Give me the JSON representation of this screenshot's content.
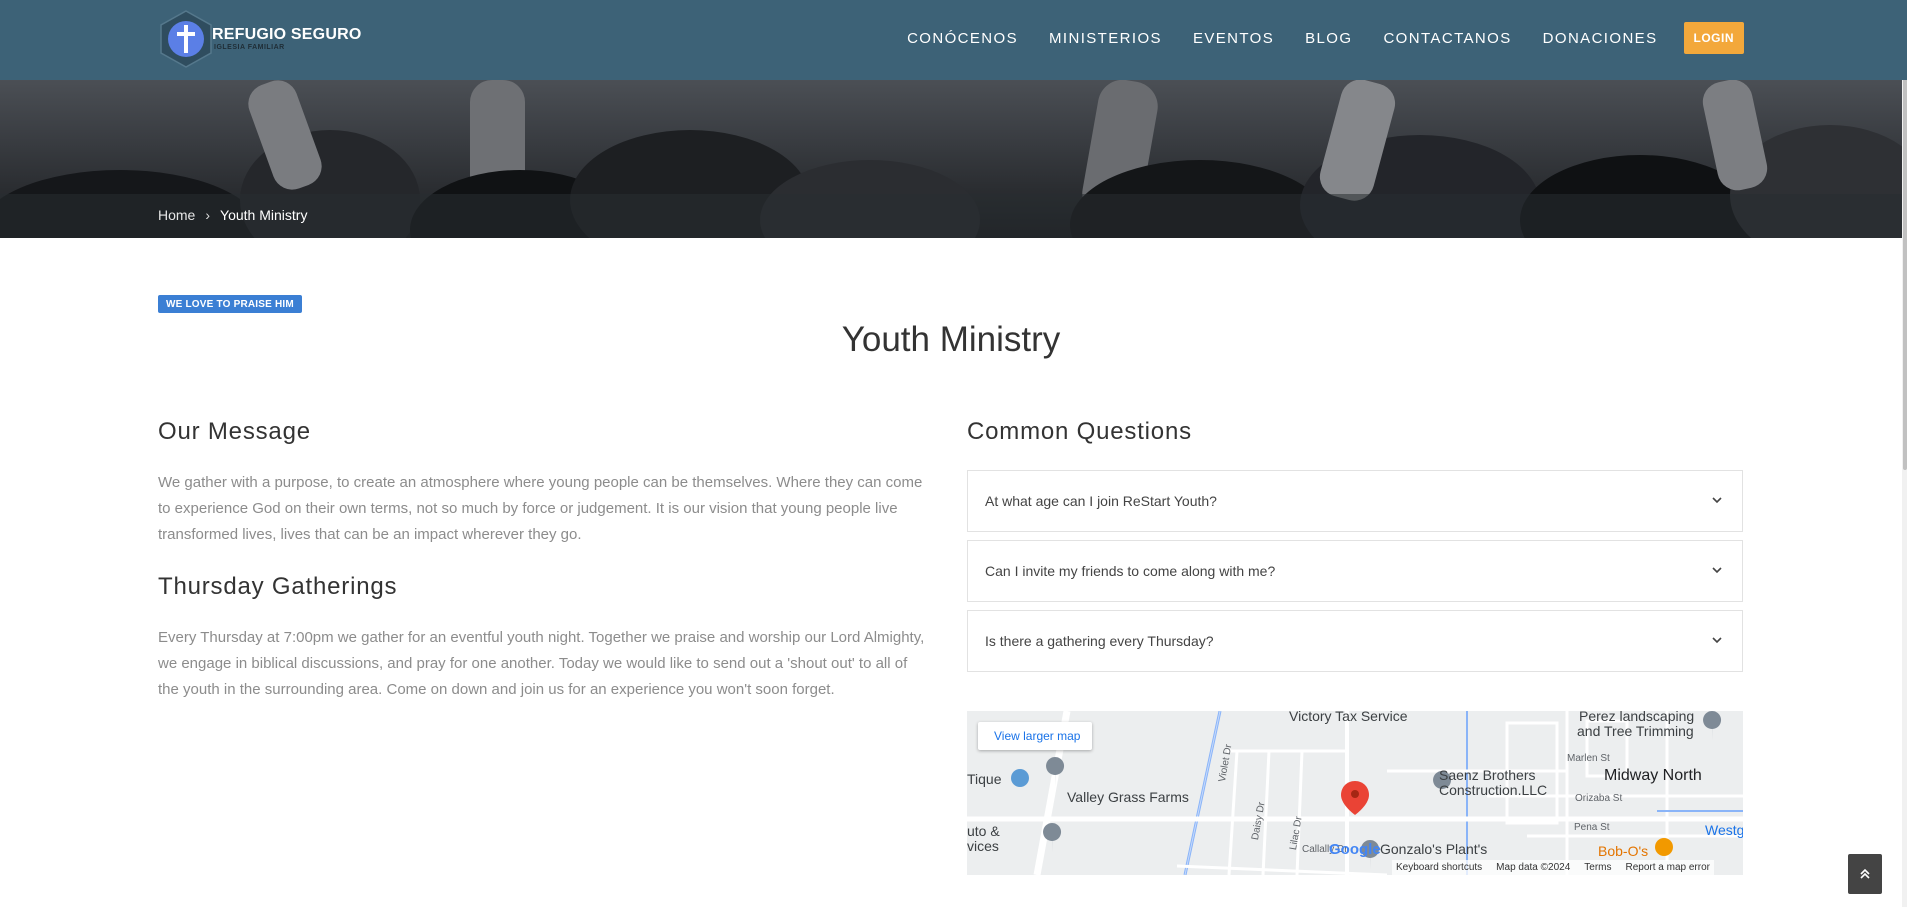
{
  "header": {
    "logo_text": "REFUGIO SEGURO",
    "logo_subtext": "IGLESIA FAMILIAR",
    "nav": [
      "CONÓCENOS",
      "MINISTERIOS",
      "EVENTOS",
      "BLOG",
      "CONTACTANOS",
      "DONACIONES"
    ],
    "login_label": "LOGIN"
  },
  "breadcrumb": {
    "home": "Home",
    "separator": "›",
    "current": "Youth Ministry"
  },
  "badge": "WE LOVE TO PRAISE HIM",
  "page_title": "Youth Ministry",
  "left": {
    "message_title": "Our Message",
    "message_text": "We gather with a purpose, to create an atmosphere where young people can be themselves. Where they can come to experience God on their own terms, not so much by force or judgement. It is our vision that young people live transformed lives, lives that can be an impact wherever they go.",
    "gatherings_title": "Thursday Gatherings",
    "gatherings_text": "Every Thursday at 7:00pm we gather for an eventful youth night. Together we praise and worship our Lord Almighty, we engage in biblical discussions, and pray for one another. Today we would like to send out a 'shout out' to all of the youth in the surrounding area. Come on down and join us for an experience you won't soon forget."
  },
  "right": {
    "questions_title": "Common Questions",
    "faqs": [
      "At what age can I join ReStart Youth?",
      "Can I invite my friends to come along with me?",
      "Is there a gathering every Thursday?"
    ]
  },
  "map": {
    "view_larger": "View larger map",
    "places": {
      "victory": "Victory Tax Service",
      "perez_1": "Perez landscaping",
      "perez_2": "and Tree Trimming",
      "tique": "Tique",
      "valley": "Valley Grass Farms",
      "saenz_1": "Saenz Brothers",
      "saenz_2": "Construction.LLC",
      "midway": "Midway North",
      "auto_1": "uto &",
      "auto_2": "vices",
      "gonzalo": "Gonzalo's Plant's",
      "bobos": "Bob-O's",
      "westg": "Westg"
    },
    "streets": {
      "violet": "Violet Dr",
      "daisy": "Daisy Dr",
      "lilac": "Lilac Dr",
      "marlen": "Marlen St",
      "orizaba": "Orizaba St",
      "pena": "Pena St",
      "callaly": "Callally Dr"
    },
    "google": "Google",
    "footer": [
      "Keyboard shortcuts",
      "Map data ©2024",
      "Terms",
      "Report a map error"
    ]
  },
  "icons": {
    "scroll_top": "double-chevron-up-icon",
    "faq_toggle": "chevron-down-icon",
    "map_pin": "map-pin-icon"
  },
  "colors": {
    "header_bg": "#3d6277",
    "login_bg": "#f3a83b",
    "badge_bg": "#3b7fd4",
    "pin_red": "#ea4335"
  }
}
